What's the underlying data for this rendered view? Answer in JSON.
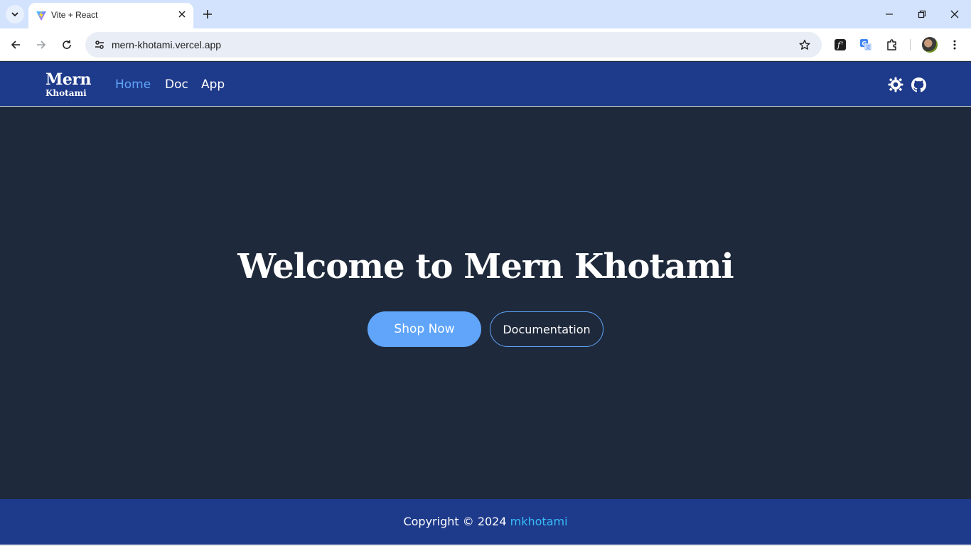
{
  "browser": {
    "tab_title": "Vite + React",
    "url": "mern-khotami.vercel.app",
    "colors": {
      "tabbar": "#d3e3fd",
      "toolbar": "#ffffff",
      "omnibox": "#e9eef6"
    }
  },
  "navbar": {
    "logo_main": "Mern",
    "logo_sub": "Khotami",
    "links": [
      {
        "label": "Home",
        "active": true
      },
      {
        "label": "Doc",
        "active": false
      },
      {
        "label": "App",
        "active": false
      }
    ],
    "icons": [
      "theme-toggle-icon",
      "github-icon"
    ]
  },
  "hero": {
    "title": "Welcome to Mern Khotami",
    "primary_button": "Shop Now",
    "secondary_button": "Documentation"
  },
  "footer": {
    "copyright": "Copyright © 2024",
    "author": "mkhotami"
  },
  "colors": {
    "nav_bg": "#1e3a8a",
    "hero_bg": "#1e293b",
    "accent": "#60a5fa",
    "footer_link": "#38bdf8"
  }
}
